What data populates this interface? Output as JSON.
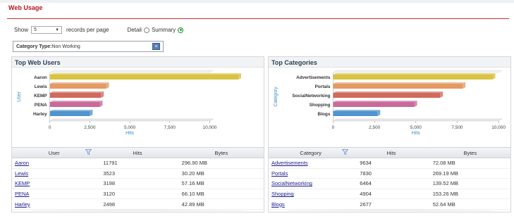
{
  "page": {
    "title": "Web Usage"
  },
  "controls": {
    "show_label": "Show",
    "per_page_value": "5",
    "per_page_suffix": "records per page",
    "detail_label": "Detail",
    "summary_label": "Summary"
  },
  "filter": {
    "text": "Category Type:",
    "value": "Non Working"
  },
  "colors": {
    "gold": "#d8c342",
    "orange": "#e49a62",
    "red": "#d06a5c",
    "pink": "#c86a9a",
    "blue": "#4f93cf",
    "accent": "#c9302c"
  },
  "users_panel": {
    "title": "Top Web Users",
    "chart_data": {
      "type": "bar",
      "orientation": "horizontal",
      "categories": [
        "Aaron",
        "Lewis",
        "KEMP",
        "PENA",
        "Harley"
      ],
      "values": [
        11791,
        3523,
        3198,
        3120,
        2498
      ],
      "colors": [
        "#d8c342",
        "#e49a62",
        "#d06a5c",
        "#c86a9a",
        "#4f93cf"
      ],
      "xlabel": "Hits",
      "ylabel": "User",
      "xlim": [
        0,
        10000
      ],
      "ticks": [
        "0",
        "2,500",
        "5,000",
        "7,500",
        "10,000"
      ]
    },
    "table": {
      "headers": [
        "User",
        "Hits",
        "Bytes"
      ],
      "rows": [
        [
          "Aaron",
          "11791",
          "296.90 MB"
        ],
        [
          "Lewis",
          "3523",
          "30.20 MB"
        ],
        [
          "KEMP",
          "3198",
          "57.16 MB"
        ],
        [
          "PENA",
          "3120",
          "66.10 MB"
        ],
        [
          "Harley",
          "2498",
          "42.89 MB"
        ]
      ]
    }
  },
  "categories_panel": {
    "title": "Top Categories",
    "chart_data": {
      "type": "bar",
      "orientation": "horizontal",
      "categories": [
        "Advertisements",
        "Portals",
        "SocialNetworking",
        "Shopping",
        "Blogs"
      ],
      "values": [
        9634,
        7830,
        6464,
        4904,
        2677
      ],
      "colors": [
        "#d8c342",
        "#e49a62",
        "#d06a5c",
        "#c86a9a",
        "#4f93cf"
      ],
      "xlabel": "Hits",
      "ylabel": "Category",
      "xlim": [
        0,
        10000
      ],
      "ticks": [
        "0",
        "2,500",
        "5,000",
        "7,500",
        "10,000"
      ]
    },
    "table": {
      "headers": [
        "Category",
        "Hits",
        "Bytes"
      ],
      "rows": [
        [
          "Advertisements",
          "9634",
          "72.08 MB"
        ],
        [
          "Portals",
          "7830",
          "269.19 MB"
        ],
        [
          "SocialNetworking",
          "6464",
          "139.52 MB"
        ],
        [
          "Shopping",
          "4904",
          "153.26 MB"
        ],
        [
          "Blogs",
          "2677",
          "52.64 MB"
        ]
      ]
    }
  }
}
